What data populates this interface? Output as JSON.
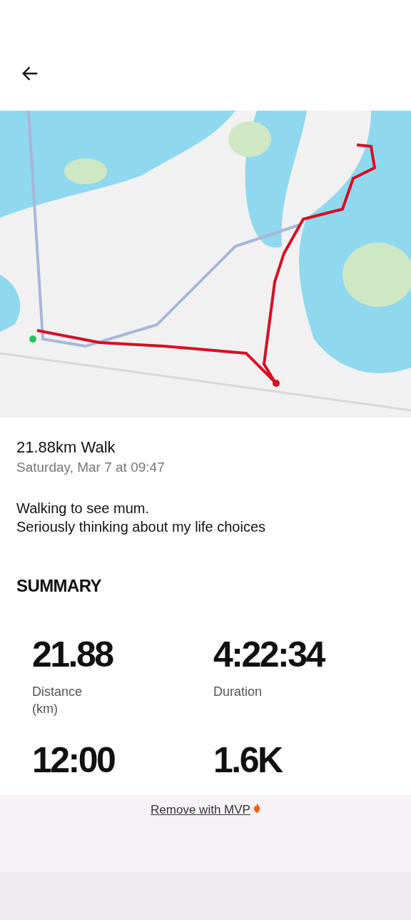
{
  "activity": {
    "title": "21.88km Walk",
    "datetime": "Saturday, Mar 7 at 09:47",
    "description": [
      "Walking to see mum.",
      "Seriously thinking about my life choices"
    ]
  },
  "summary": {
    "heading": "SUMMARY",
    "stats": [
      {
        "value": "21.88",
        "label": "Distance (km)"
      },
      {
        "value": "4:22:34",
        "label": "Duration"
      },
      {
        "value": "12:00"
      },
      {
        "value": "1.6K"
      }
    ]
  },
  "banner": {
    "link": "Remove with MVP"
  }
}
